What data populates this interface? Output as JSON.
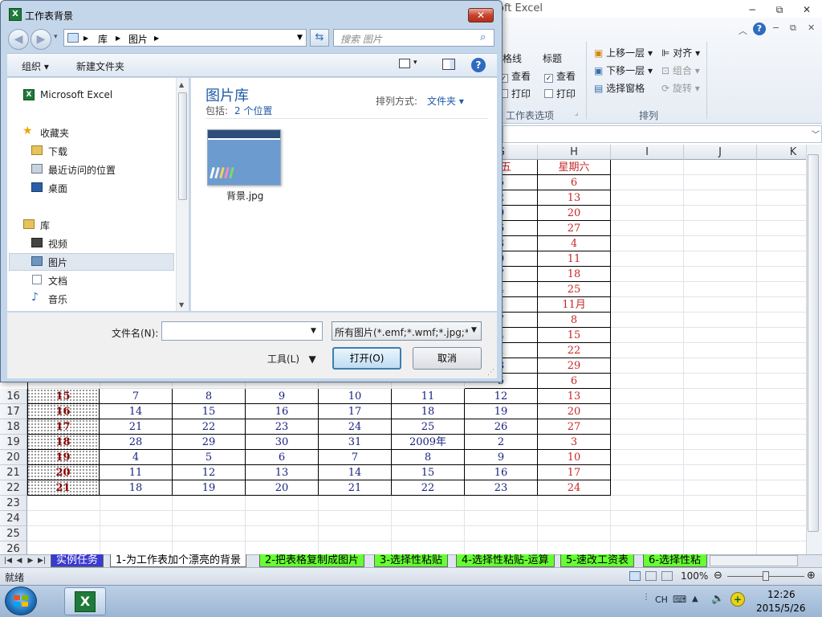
{
  "excel": {
    "title_partial": "oft Excel",
    "window_controls": {
      "minimize": "−",
      "restore": "⧉",
      "close": "✕"
    },
    "ribbon": {
      "gridlines_label": "格线",
      "headings_label": "标题",
      "view_label": "查看",
      "print_label": "打印",
      "sheet_options_label": "工作表选项",
      "bring_forward": "上移一层",
      "send_backward": "下移一层",
      "selection_pane": "选择窗格",
      "align": "对齐",
      "group": "组合",
      "rotate": "旋转",
      "arrange_label": "排列"
    },
    "columns": [
      "G",
      "H",
      "I",
      "J",
      "K"
    ],
    "header_row": {
      "fri_partial": "期五",
      "sat": "星期六"
    },
    "right_col_G": [
      "5",
      "2",
      "9",
      "6",
      "3",
      "0",
      "7",
      "4",
      "1",
      "7",
      "4",
      "1",
      "8",
      "5"
    ],
    "right_col_H": [
      "6",
      "13",
      "20",
      "27",
      "4",
      "11",
      "18",
      "25",
      "11月",
      "8",
      "15",
      "22",
      "29",
      "6"
    ],
    "full_rows": [
      {
        "row": "16",
        "wk": "15",
        "vals": [
          "7",
          "8",
          "9",
          "10",
          "11",
          "12",
          "13"
        ]
      },
      {
        "row": "17",
        "wk": "16",
        "vals": [
          "14",
          "15",
          "16",
          "17",
          "18",
          "19",
          "20"
        ]
      },
      {
        "row": "18",
        "wk": "17",
        "vals": [
          "21",
          "22",
          "23",
          "24",
          "25",
          "26",
          "27"
        ]
      },
      {
        "row": "19",
        "wk": "18",
        "vals": [
          "28",
          "29",
          "30",
          "31",
          "2009年",
          "2",
          "3"
        ]
      },
      {
        "row": "20",
        "wk": "19",
        "vals": [
          "4",
          "5",
          "6",
          "7",
          "8",
          "9",
          "10"
        ]
      },
      {
        "row": "21",
        "wk": "20",
        "vals": [
          "11",
          "12",
          "13",
          "14",
          "15",
          "16",
          "17"
        ]
      },
      {
        "row": "22",
        "wk": "21",
        "vals": [
          "18",
          "19",
          "20",
          "21",
          "22",
          "23",
          "24"
        ]
      }
    ],
    "empty_rows": [
      "23",
      "24",
      "25",
      "26"
    ],
    "sheet_tabs": [
      {
        "label": "实例任务",
        "active": false
      },
      {
        "label": "1-为工作表加个漂亮的背景",
        "active": true
      },
      {
        "label": "2-把表格复制成图片",
        "active": false
      },
      {
        "label": "3-选择性粘贴",
        "active": false
      },
      {
        "label": "4-选择性粘贴-运算",
        "active": false
      },
      {
        "label": "5-速改工资表",
        "active": false
      },
      {
        "label": "6-选择性粘",
        "active": false
      }
    ],
    "status": {
      "ready": "就绪",
      "zoom": "100%"
    }
  },
  "taskbar": {
    "lang": "CH",
    "time": "12:26",
    "date": "2015/5/26"
  },
  "dialog": {
    "title": "工作表背景",
    "close": "✕",
    "breadcrumb": [
      "库",
      "图片"
    ],
    "search_placeholder": "搜索 图片",
    "toolbar": {
      "organize": "组织",
      "new_folder": "新建文件夹"
    },
    "nav": {
      "microsoft_excel": "Microsoft Excel",
      "favorites": "收藏夹",
      "downloads": "下载",
      "recent": "最近访问的位置",
      "desktop": "桌面",
      "libraries": "库",
      "videos": "视频",
      "pictures": "图片",
      "documents": "文档",
      "music": "音乐"
    },
    "library": {
      "title": "图片库",
      "includes_label": "包括:",
      "includes_value": "2 个位置",
      "arrange_label": "排列方式:",
      "arrange_value": "文件夹"
    },
    "file": {
      "name": "背景.jpg"
    },
    "filename_label": "文件名(N):",
    "filename_value": "",
    "filter": "所有图片(*.emf;*.wmf;*.jpg;*.jp",
    "tools": "工具(L)",
    "open": "打开(O)",
    "cancel": "取消"
  },
  "colors": {
    "accent_blue": "#1e5aa8",
    "weekend_red": "#c62828",
    "date_blue": "#1a237e",
    "tab_green": "#66ff33"
  }
}
